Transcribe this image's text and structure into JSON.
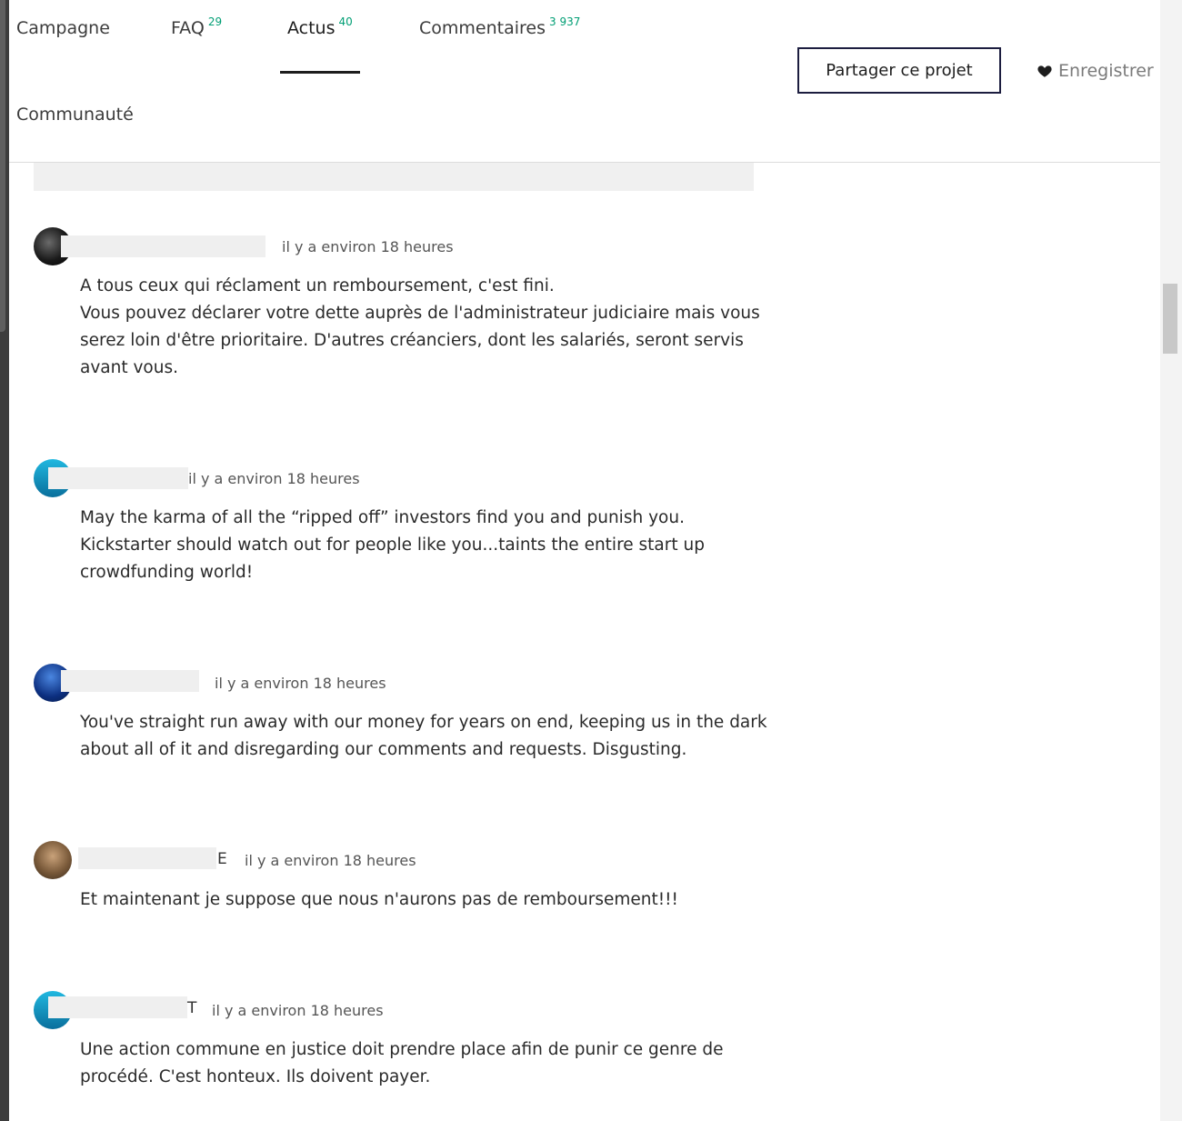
{
  "tabs": {
    "campaign": {
      "label": "Campagne"
    },
    "faq": {
      "label": "FAQ",
      "count": "29"
    },
    "news": {
      "label": "Actus",
      "count": "40"
    },
    "comments": {
      "label": "Commentaires",
      "count": "3 937"
    },
    "community": {
      "label": "Communauté"
    }
  },
  "actions": {
    "share_label": "Partager ce projet",
    "save_label": "Enregistrer"
  },
  "comments": [
    {
      "time": "il y a environ 18 heures",
      "lines": [
        "A tous ceux qui réclament un remboursement, c'est fini.",
        "Vous pouvez déclarer votre dette auprès de l'administrateur judiciaire mais vous serez loin d'être prioritaire. D'autres créanciers, dont les salariés, seront servis avant vous."
      ]
    },
    {
      "time": "il y a environ 18 heures",
      "lines": [
        "May the karma of all the “ripped off” investors find you and punish you.",
        "Kickstarter should watch out for people like you...taints the entire start up crowdfunding world!"
      ]
    },
    {
      "time": "il y a environ 18 heures",
      "lines": [
        "You've straight run away with our money for years on end, keeping us in the dark about all of it and disregarding our comments and requests. Disgusting."
      ]
    },
    {
      "name_tail": "E",
      "time": "il y a environ 18 heures",
      "lines": [
        "Et maintenant je suppose que nous n'aurons pas de remboursement!!!"
      ]
    },
    {
      "name_tail": "T",
      "time": "il y a environ 18 heures",
      "lines": [
        "Une action commune en justice doit prendre place afin de punir ce genre de procédé. C'est honteux. Ils doivent payer."
      ]
    }
  ],
  "colors": {
    "accent_green": "#009e74",
    "button_border": "#1c1d3f"
  },
  "icons": [
    "heart-icon"
  ]
}
